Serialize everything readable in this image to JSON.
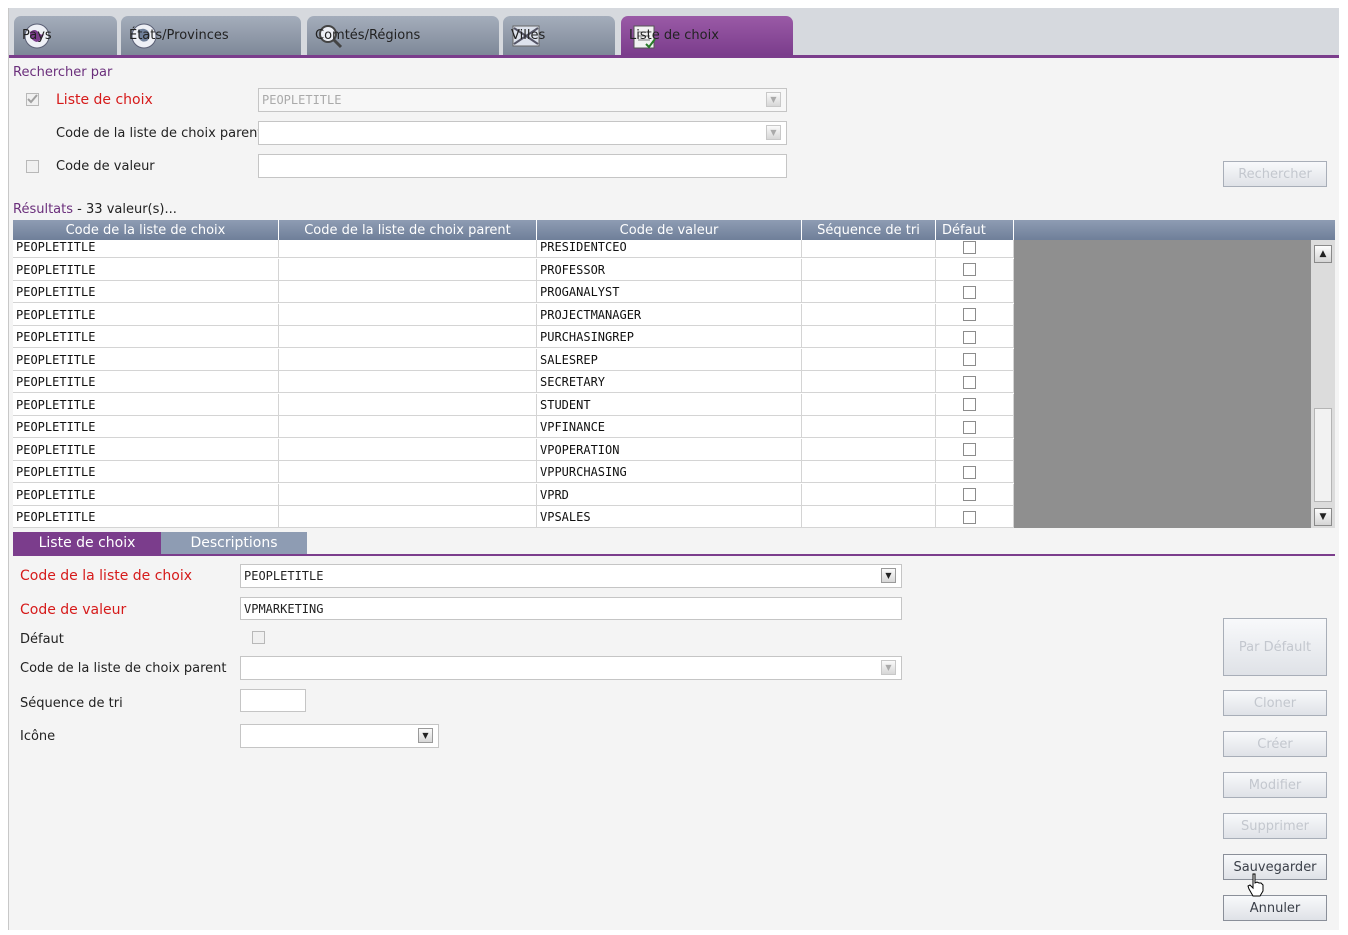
{
  "tabs": [
    {
      "label": "Pays",
      "icon": "globe-icon"
    },
    {
      "label": "États/Provinces",
      "icon": "globe-icon"
    },
    {
      "label": "Comtés/Régions",
      "icon": "magnifier-icon"
    },
    {
      "label": "Villes",
      "icon": "city-icon"
    },
    {
      "label": "Liste de choix",
      "icon": "notepad-icon",
      "active": true
    }
  ],
  "search": {
    "title": "Rechercher par",
    "list_label": "Liste de choix",
    "list_value": "PEOPLETITLE",
    "list_checked": true,
    "parent_label": "Code de la liste de choix parent",
    "parent_value": "",
    "value_label": "Code de valeur",
    "value_value": "",
    "value_checked": false,
    "search_button": "Rechercher"
  },
  "results": {
    "label": "Résultats",
    "dash": "-",
    "count": "33",
    "suffix": "valeur(s)...",
    "columns": [
      "Code de la liste de choix",
      "Code de la liste de choix parent",
      "Code de valeur",
      "Séquence de tri",
      "Défaut"
    ],
    "rows": [
      {
        "list": "PEOPLETITLE",
        "parent": "",
        "value": "PRESIDENTCEO",
        "seq": "",
        "default": false
      },
      {
        "list": "PEOPLETITLE",
        "parent": "",
        "value": "PROFESSOR",
        "seq": "",
        "default": false
      },
      {
        "list": "PEOPLETITLE",
        "parent": "",
        "value": "PROGANALYST",
        "seq": "",
        "default": false
      },
      {
        "list": "PEOPLETITLE",
        "parent": "",
        "value": "PROJECTMANAGER",
        "seq": "",
        "default": false
      },
      {
        "list": "PEOPLETITLE",
        "parent": "",
        "value": "PURCHASINGREP",
        "seq": "",
        "default": false
      },
      {
        "list": "PEOPLETITLE",
        "parent": "",
        "value": "SALESREP",
        "seq": "",
        "default": false
      },
      {
        "list": "PEOPLETITLE",
        "parent": "",
        "value": "SECRETARY",
        "seq": "",
        "default": false
      },
      {
        "list": "PEOPLETITLE",
        "parent": "",
        "value": "STUDENT",
        "seq": "",
        "default": false
      },
      {
        "list": "PEOPLETITLE",
        "parent": "",
        "value": "VPFINANCE",
        "seq": "",
        "default": false
      },
      {
        "list": "PEOPLETITLE",
        "parent": "",
        "value": "VPOPERATION",
        "seq": "",
        "default": false
      },
      {
        "list": "PEOPLETITLE",
        "parent": "",
        "value": "VPPURCHASING",
        "seq": "",
        "default": false
      },
      {
        "list": "PEOPLETITLE",
        "parent": "",
        "value": "VPRD",
        "seq": "",
        "default": false
      },
      {
        "list": "PEOPLETITLE",
        "parent": "",
        "value": "VPSALES",
        "seq": "",
        "default": false
      }
    ]
  },
  "subtabs": [
    "Liste de choix",
    "Descriptions"
  ],
  "form": {
    "list_code_label": "Code de la liste de choix",
    "list_code_value": "PEOPLETITLE",
    "value_code_label": "Code de valeur",
    "value_code_value": "VPMARKETING",
    "default_label": "Défaut",
    "parent_label": "Code de la liste de choix parent",
    "parent_value": "",
    "seq_label": "Séquence de tri",
    "seq_value": "",
    "icon_label": "Icône",
    "icon_value": ""
  },
  "actions": {
    "default": "Par Défault",
    "clone": "Cloner",
    "create": "Créer",
    "modify": "Modifier",
    "delete": "Supprimer",
    "save": "Sauvegarder",
    "cancel": "Annuler"
  },
  "colors": {
    "accent": "#7b3d8c",
    "required": "#d61a1a",
    "header": "#7f8ea7"
  }
}
